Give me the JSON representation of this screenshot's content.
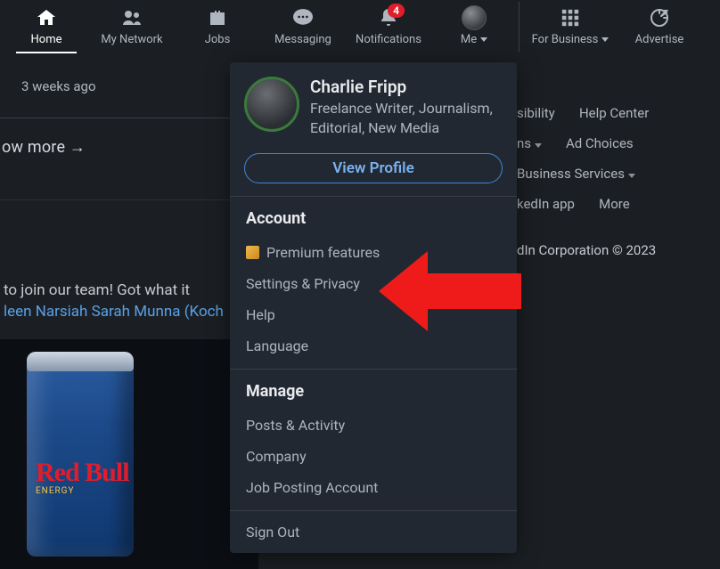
{
  "nav": {
    "home": "Home",
    "network": "My Network",
    "jobs": "Jobs",
    "messaging": "Messaging",
    "notifications": "Notifications",
    "notif_badge": "4",
    "me": "Me",
    "business": "For Business",
    "advertise": "Advertise"
  },
  "feed": {
    "timestamp": "3 weeks ago",
    "show_more": "ow more →",
    "line1": "to join our team! Got what it",
    "line2_link": "leen Narsiah Sarah Munna (Koch"
  },
  "right": {
    "sibility": "sibility",
    "help_center": "Help Center",
    "ns": "ns",
    "ad_choices": "Ad Choices",
    "business_services": "Business Services",
    "kedin_app": "kedIn app",
    "more": "More",
    "copyright": "dIn Corporation © 2023"
  },
  "dropdown": {
    "name": "Charlie Fripp",
    "subtitle": "Freelance Writer, Journalism, Editorial, New Media",
    "view_profile": "View Profile",
    "account_heading": "Account",
    "premium": "Premium features",
    "settings": "Settings & Privacy",
    "help": "Help",
    "language": "Language",
    "manage_heading": "Manage",
    "posts": "Posts & Activity",
    "company": "Company",
    "job_posting": "Job Posting Account",
    "signout": "Sign Out"
  },
  "can": {
    "brand": "Red Bull",
    "tag": "ENERGY"
  }
}
